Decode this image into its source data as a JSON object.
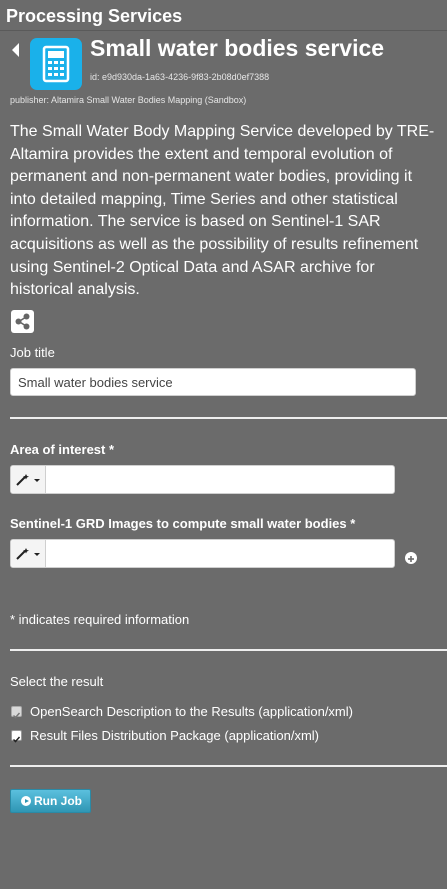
{
  "panel": {
    "title": "Processing Services"
  },
  "service": {
    "title": "Small water bodies service",
    "id": "id: e9d930da-1a63-4236-9f83-2b08d0ef7388",
    "publisher": "publisher: Altamira Small Water Bodies Mapping (Sandbox)",
    "description": "The Small Water Body Mapping Service developed by TRE-Altamira provides the extent and temporal evolution of permanent and non-permanent water bodies, providing it into detailed mapping, Time Series and other statistical information. The service is based on Sentinel-1 SAR acquisitions as well as the possibility of results refinement using Sentinel-2 Optical Data and ASAR archive for historical analysis.",
    "icon": "calculator-icon",
    "accent": "#1ab1ea"
  },
  "form": {
    "job_title_label": "Job title",
    "job_title_value": "Small water bodies service",
    "aoi_label": "Area of interest *",
    "aoi_value": "",
    "s1_label": "Sentinel-1 GRD Images to compute small water bodies *",
    "s1_value": "",
    "required_note": "* indicates required information",
    "select_result_label": "Select the result",
    "results": [
      {
        "label": "OpenSearch Description to the Results (application/xml)",
        "checked": true,
        "disabled": true
      },
      {
        "label": "Result Files Distribution Package (application/xml)",
        "checked": true,
        "disabled": false
      }
    ],
    "run_label": "Run Job"
  }
}
